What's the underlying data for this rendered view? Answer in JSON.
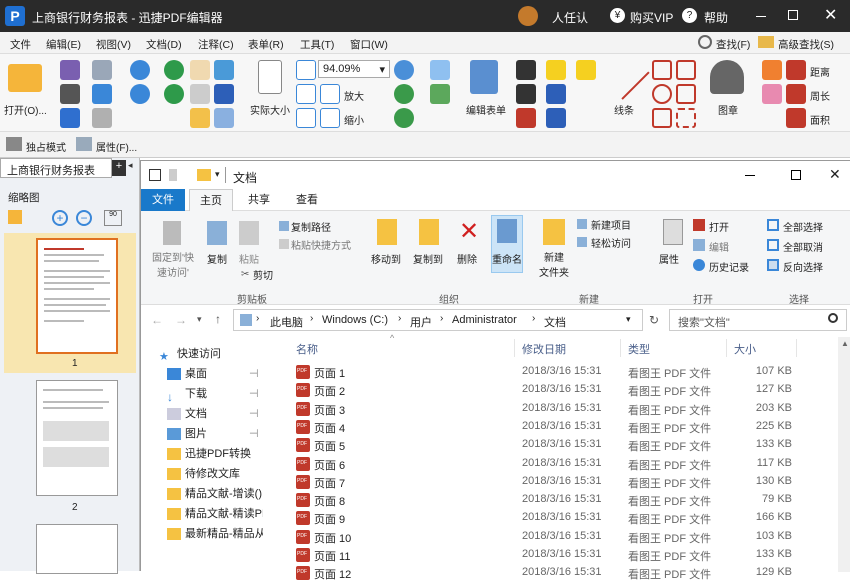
{
  "app": {
    "title": "上商银行财务报表 - 迅捷PDF编辑器",
    "user_label": "人任认",
    "buy_vip": "购买VIP",
    "help": "帮助"
  },
  "menu": [
    "文件",
    "编辑(E)",
    "视图(V)",
    "文档(D)",
    "注释(C)",
    "表单(R)",
    "工具(T)",
    "窗口(W)"
  ],
  "menu_right": [
    "查找(F)",
    "高级查找(S)"
  ],
  "toolbar": {
    "open": "打开(O)...",
    "zoom": "94.09%",
    "actual_size": "实际大小",
    "zoom_in": "放大",
    "zoom_out": "缩小",
    "edit_content": "编辑表单",
    "line": "线条",
    "stamp": "图章",
    "distance": "距离",
    "perimeter": "周长",
    "area": "面积"
  },
  "toolbar2": {
    "exclusive_mode": "独占模式",
    "properties": "属性(F)..."
  },
  "left_panel": {
    "doc_tab": "上商银行财务报表",
    "thumbnails_label": "缩略图",
    "pages": [
      "1",
      "2"
    ]
  },
  "explorer": {
    "title": "文档",
    "tabs": [
      "文件",
      "主页",
      "共享",
      "查看"
    ],
    "ribbon": {
      "pin_quick": "固定到'快\n速访问'",
      "copy": "复制",
      "paste": "粘贴",
      "copy_path": "复制路径",
      "paste_shortcut": "粘贴快捷方式",
      "cut": "剪切",
      "clipboard_group": "剪贴板",
      "move_to": "移动到",
      "copy_to": "复制到",
      "delete": "删除",
      "rename": "重命名",
      "organize_group": "组织",
      "new_folder": "新建\n文件夹",
      "new_item": "新建项目",
      "easy_access": "轻松访问",
      "new_group": "新建",
      "properties": "属性",
      "open": "打开",
      "edit": "编辑",
      "history": "历史记录",
      "open_group": "打开",
      "select_all": "全部选择",
      "select_none": "全部取消",
      "invert": "反向选择",
      "select_group": "选择"
    },
    "address": [
      "此电脑",
      "Windows (C:)",
      "用户",
      "Administrator",
      "文档"
    ],
    "search_placeholder": "搜索\"文档\"",
    "nav": [
      "快速访问",
      "桌面",
      "下载",
      "文档",
      "图片",
      "迅捷PDF转换",
      "待修改文库",
      "精品文献-增读()",
      "精品文献-精读PD",
      "最新精品-精品从"
    ],
    "columns": [
      "名称",
      "修改日期",
      "类型",
      "大小"
    ],
    "files": [
      {
        "name": "页面 1",
        "date": "2018/3/16 15:31",
        "type": "看图王 PDF 文件",
        "size": "107 KB"
      },
      {
        "name": "页面 2",
        "date": "2018/3/16 15:31",
        "type": "看图王 PDF 文件",
        "size": "127 KB"
      },
      {
        "name": "页面 3",
        "date": "2018/3/16 15:31",
        "type": "看图王 PDF 文件",
        "size": "203 KB"
      },
      {
        "name": "页面 4",
        "date": "2018/3/16 15:31",
        "type": "看图王 PDF 文件",
        "size": "225 KB"
      },
      {
        "name": "页面 5",
        "date": "2018/3/16 15:31",
        "type": "看图王 PDF 文件",
        "size": "133 KB"
      },
      {
        "name": "页面 6",
        "date": "2018/3/16 15:31",
        "type": "看图王 PDF 文件",
        "size": "117 KB"
      },
      {
        "name": "页面 7",
        "date": "2018/3/16 15:31",
        "type": "看图王 PDF 文件",
        "size": "130 KB"
      },
      {
        "name": "页面 8",
        "date": "2018/3/16 15:31",
        "type": "看图王 PDF 文件",
        "size": "79 KB"
      },
      {
        "name": "页面 9",
        "date": "2018/3/16 15:31",
        "type": "看图王 PDF 文件",
        "size": "166 KB"
      },
      {
        "name": "页面 10",
        "date": "2018/3/16 15:31",
        "type": "看图王 PDF 文件",
        "size": "103 KB"
      },
      {
        "name": "页面 11",
        "date": "2018/3/16 15:31",
        "type": "看图王 PDF 文件",
        "size": "133 KB"
      },
      {
        "name": "页面 12",
        "date": "2018/3/16 15:31",
        "type": "看图王 PDF 文件",
        "size": "129 KB"
      }
    ]
  }
}
